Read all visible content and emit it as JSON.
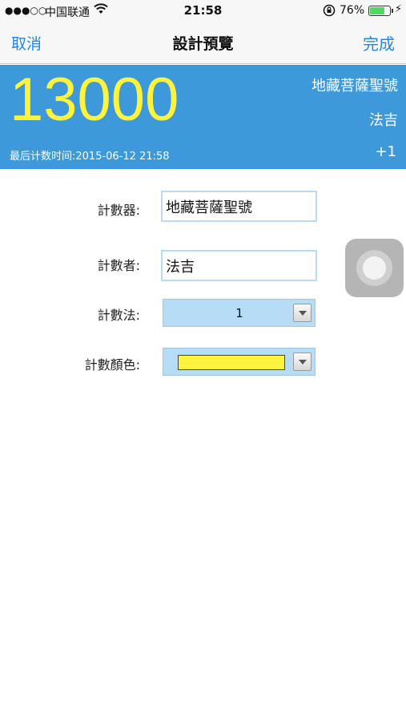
{
  "status_bar": {
    "signal": "●●●○○",
    "carrier": "中国联通",
    "time": "21:58",
    "battery_percent": "76%",
    "battery_level": 0.76,
    "battery_color": "#4cd964"
  },
  "nav": {
    "cancel_label": "取消",
    "title": "設計預覽",
    "done_label": "完成",
    "accent_color": "#1e88e5"
  },
  "counter": {
    "count": "13000",
    "name": "地藏菩薩聖號",
    "person": "法吉",
    "last_time": "最后计数时间:2015-06-12 21:58",
    "step": "+1",
    "panel_color": "#3d99d9",
    "count_color": "#fff33b"
  },
  "form": {
    "counter_label": "計數器:",
    "counter_value": "地藏菩薩聖號",
    "counter_person_label": "計數者:",
    "counter_person_value": "法吉",
    "method_label": "計數法:",
    "method_value": "1",
    "color_label": "計數顏色:",
    "color_value": "#fff33b"
  },
  "icons": {
    "wifi": "wifi-icon",
    "lock": "rotation-lock-icon",
    "charging": "charging-bolt-icon",
    "dropdown": "chevron-down-icon",
    "assistive": "assistive-touch-icon"
  }
}
